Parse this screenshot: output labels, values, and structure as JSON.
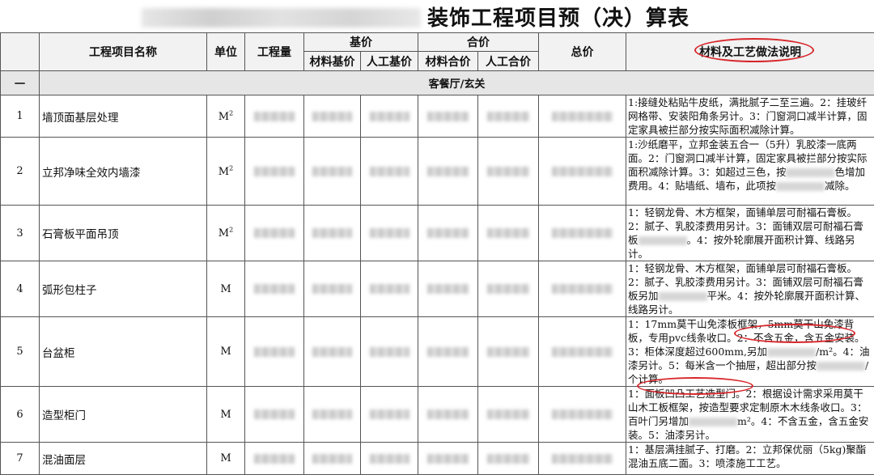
{
  "title": "装饰工程项目预（决）算表",
  "headers": {
    "name": "工程项目名称",
    "unit": "单位",
    "qty": "工程量",
    "base_price": "基价",
    "combined_price": "合价",
    "material_base": "材料基价",
    "labor_base": "人工基价",
    "material_total": "材料合价",
    "labor_total": "人工合价",
    "total": "总价",
    "notes": "材料及工艺做法说明"
  },
  "section": {
    "index": "一",
    "name": "客餐厅/玄关"
  },
  "rows": [
    {
      "no": "1",
      "name": "墙顶面基层处理",
      "unit": "M²",
      "notes": "1:接缝处粘贴牛皮纸，满批腻子二至三遍。2：挂玻纤网格带、安装阳角条另计。3：门窗洞口减半计算，固定家具被拦部分按实际面积减除计算。"
    },
    {
      "no": "2",
      "name": "立邦净味全效内墙漆",
      "unit": "M²",
      "notes": "1:沙纸磨平，立邦金装五合一（5升）乳胶漆一底两面。2：门窗洞口减半计算，固定家具被拦部分按实际面积减除计算。3：如超过三色，按",
      "notes_b": "色增加费用。4：贴墙纸、墙布，此项按",
      "notes_c": "减除。"
    },
    {
      "no": "3",
      "name": "石膏板平面吊顶",
      "unit": "M²",
      "notes": "1：轻钢龙骨、木方框架，面铺单层可耐福石膏板。2：腻子、乳胶漆费用另计。3：面铺双层可耐福石膏板",
      "notes_b": "。4：按外轮廓展开面积计算、线路另计。"
    },
    {
      "no": "4",
      "name": "弧形包柱子",
      "unit": "M",
      "notes": "1：轻钢龙骨、木方框架，面铺单层可耐福石膏板。2：腻子、乳胶漆费用另计。3：面铺双层可耐福石膏板另加",
      "notes_b": "平米。4：按外轮廓展开面积计算、线路另计。"
    },
    {
      "no": "5",
      "name": "台盆柜",
      "unit": "M",
      "notes": "1：17mm莫干山免漆板框架，5mm莫干山免漆背板，专用pvc线条收口。2：不含五金，含五金安装。3：柜体深度超过600mm,另加",
      "notes_b": "/m²。4：油漆另计。5：每米含一个抽屉，超出部分按",
      "notes_c": "/个计算。"
    },
    {
      "no": "6",
      "name": "造型柜门",
      "unit": "M",
      "notes": "1：面板凹凸工艺造型门。2：根据设计需求采用莫干山木工板框架，按造型要求定制原木木线条收口。3：百叶门另增加",
      "notes_b": "m²。4：不含五金，含五金安装。5：油漆另计。"
    },
    {
      "no": "7",
      "name": "混油面层",
      "unit": "M",
      "notes": "1：基层满挂腻子、打磨。2：立邦保优丽（5kg)聚酯混油五底二面。3：喷漆施工工艺。"
    }
  ],
  "colors": {
    "highlight": "#d8262b",
    "header_bg": "#f2f2f2"
  }
}
